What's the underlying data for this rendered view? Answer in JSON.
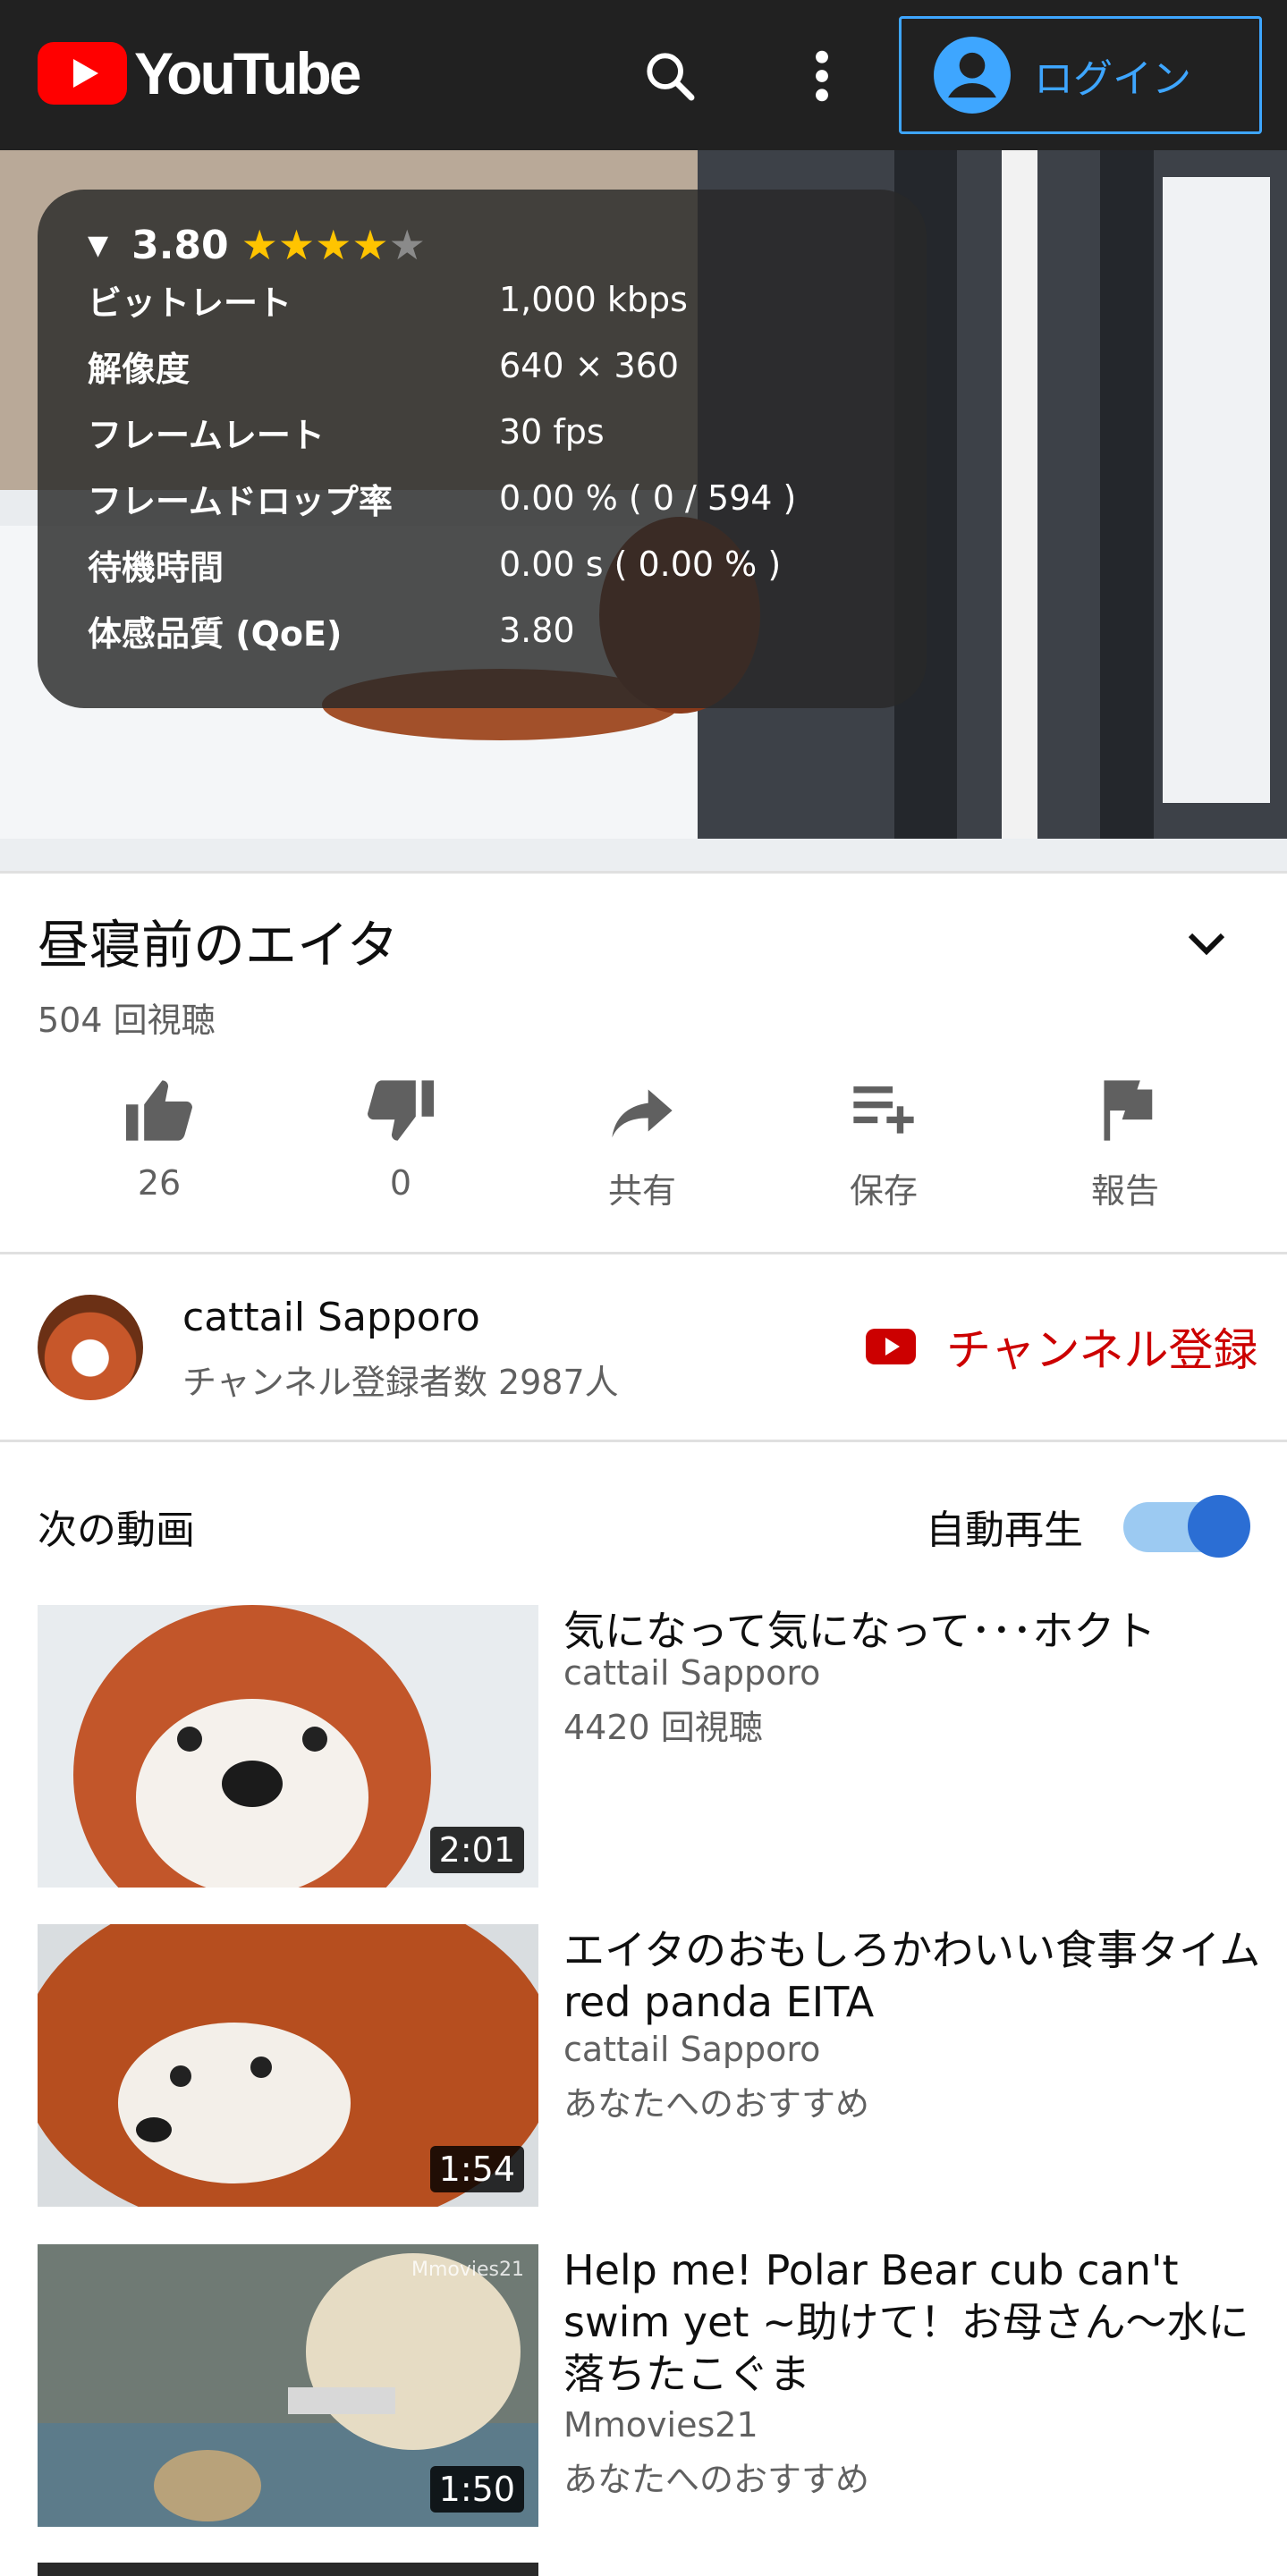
{
  "header": {
    "logo_text": "YouTube",
    "login_label": "ログイン"
  },
  "stats": {
    "rating": "3.80",
    "stars_filled": 4,
    "stars_total": 5,
    "rows": [
      {
        "label": "ビットレート",
        "value": "1,000 kbps"
      },
      {
        "label": "解像度",
        "value": "640 × 360"
      },
      {
        "label": "フレームレート",
        "value": "30 fps"
      },
      {
        "label": "フレームドロップ率",
        "value": "0.00 % ( 0 / 594 )"
      },
      {
        "label": "待機時間",
        "value": "0.00 s ( 0.00 % )"
      },
      {
        "label": "体感品質 (QoE)",
        "value": "3.80"
      }
    ]
  },
  "video": {
    "title": "昼寝前のエイタ",
    "views": "504 回視聴",
    "likes": "26",
    "dislikes": "0",
    "share": "共有",
    "save": "保存",
    "report": "報告"
  },
  "channel": {
    "name": "cattail Sapporo",
    "subscribers": "チャンネル登録者数 2987人",
    "subscribe_label": "チャンネル登録"
  },
  "upnext": {
    "label": "次の動画",
    "autoplay_label": "自動再生",
    "autoplay_on": true,
    "items": [
      {
        "title": "気になって気になって･･･ホクト",
        "channel": "cattail Sapporo",
        "meta": "4420 回視聴",
        "duration": "2:01"
      },
      {
        "title": "エイタのおもしろかわいい食事タイム red panda EITA",
        "channel": "cattail Sapporo",
        "meta": "あなたへのおすすめ",
        "duration": "1:54"
      },
      {
        "title": "Help me! Polar Bear cub can't swim yet ~助けて！お母さん〜水に落ちたこぐま",
        "channel": "Mmovies21",
        "meta": "あなたへのおすすめ",
        "duration": "1:50",
        "watermark": "Mmovies21"
      }
    ]
  },
  "colors": {
    "header_bg": "#212121",
    "accent_blue": "#3ea6ff",
    "subscribe_red": "#cc0000",
    "star": "#ffc400"
  }
}
